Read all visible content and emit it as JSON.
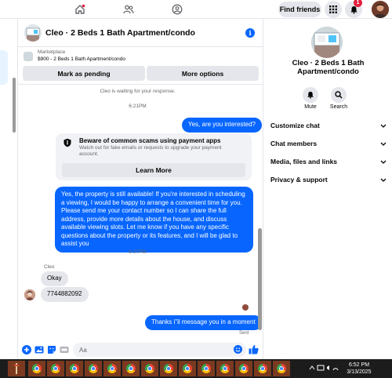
{
  "topnav": {
    "find_friends": "Find friends",
    "notif_count": "1"
  },
  "chat": {
    "title": "Cleo · 2 Beds 1 Bath Apartment/condo",
    "marketplace_tag": "Marketplace",
    "listing_info": "$900 - 2 Beds 1 Bath Apartment/condo",
    "mark_pending": "Mark as pending",
    "more_options": "More options",
    "waiting_notice": "Cleo is waiting for your response.",
    "ts1": "6:21PM",
    "msg1": "Yes, are you interested?",
    "scam_title": "Beware of common scams using payment apps",
    "scam_sub": "Watch out for fake emails or requests to upgrade your payment account.",
    "learn_more": "Learn More",
    "msg2": "Yes, the property is still available! If you're interested in scheduling a viewing, I would be happy to arrange a convenient time for you. Please send me your contact number so I can share the full address, provide more details about the house, and discuss available viewing slots. Let me know if you have any specific questions about the property or its features, and I will be glad to assist you",
    "ts2": "6:37PM",
    "sender": "Cleo",
    "msg3": "Okay",
    "msg4": "7744882092",
    "msg5": "Thanks i\"il message you in a moment",
    "sent": "Sent",
    "composer_placeholder": "Aa"
  },
  "right": {
    "title": "Cleo · 2 Beds 1 Bath Apartment/condo",
    "mute": "Mute",
    "search": "Search",
    "rows": [
      "Customize chat",
      "Chat members",
      "Media, files and links",
      "Privacy & support"
    ]
  },
  "taskbar": {
    "time": "6:52 PM",
    "date": "3/13/2025"
  },
  "colors": {
    "accent": "#0866ff",
    "bubble_in": "#e4e6eb",
    "notif": "#e41e3f"
  }
}
